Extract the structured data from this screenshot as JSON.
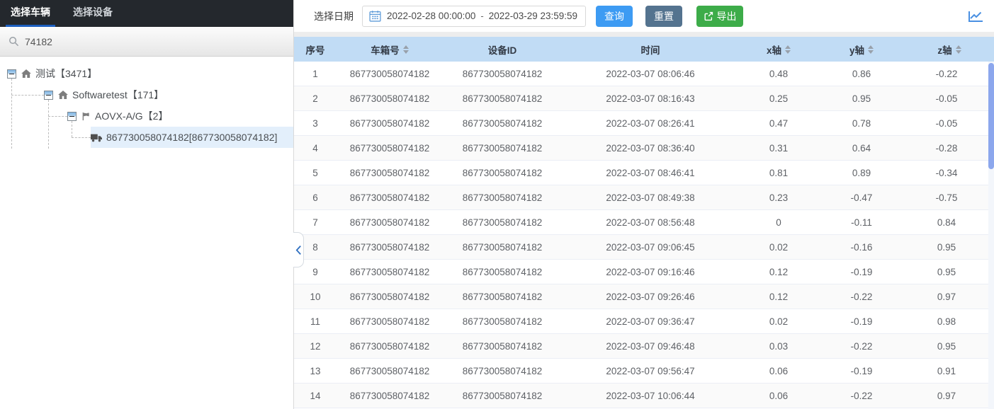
{
  "left_panel": {
    "tabs": [
      {
        "label": "选择车辆",
        "active": true
      },
      {
        "label": "选择设备",
        "active": false
      }
    ],
    "search": {
      "value": "74182"
    },
    "tree": {
      "nodes": [
        {
          "label": "测试【3471】",
          "icon": "home",
          "indent": 0,
          "expander": true,
          "selected": false
        },
        {
          "label": "Softwaretest【171】",
          "icon": "home",
          "indent": 1,
          "expander": true,
          "selected": false
        },
        {
          "label": "AOVX-A/G【2】",
          "icon": "flag",
          "indent": 2,
          "expander": true,
          "selected": false
        },
        {
          "label": "867730058074182[867730058074182]",
          "icon": "truck",
          "indent": 3,
          "expander": false,
          "selected": true
        }
      ]
    }
  },
  "toolbar": {
    "date_label": "选择日期",
    "date_start": "2022-02-28 00:00:00",
    "date_separator": "-",
    "date_end": "2022-03-29 23:59:59",
    "query_label": "查询",
    "reset_label": "重置",
    "export_label": "导出"
  },
  "table": {
    "columns": [
      {
        "label": "序号",
        "sortable": false
      },
      {
        "label": "车箱号",
        "sortable": true
      },
      {
        "label": "设备ID",
        "sortable": false
      },
      {
        "label": "时间",
        "sortable": false
      },
      {
        "label": "x轴",
        "sortable": true
      },
      {
        "label": "y轴",
        "sortable": true
      },
      {
        "label": "z轴",
        "sortable": true
      }
    ],
    "rows": [
      [
        "1",
        "867730058074182",
        "867730058074182",
        "2022-03-07 08:06:46",
        "0.48",
        "0.86",
        "-0.22"
      ],
      [
        "2",
        "867730058074182",
        "867730058074182",
        "2022-03-07 08:16:43",
        "0.25",
        "0.95",
        "-0.05"
      ],
      [
        "3",
        "867730058074182",
        "867730058074182",
        "2022-03-07 08:26:41",
        "0.47",
        "0.78",
        "-0.05"
      ],
      [
        "4",
        "867730058074182",
        "867730058074182",
        "2022-03-07 08:36:40",
        "0.31",
        "0.64",
        "-0.28"
      ],
      [
        "5",
        "867730058074182",
        "867730058074182",
        "2022-03-07 08:46:41",
        "0.81",
        "0.89",
        "-0.34"
      ],
      [
        "6",
        "867730058074182",
        "867730058074182",
        "2022-03-07 08:49:38",
        "0.23",
        "-0.47",
        "-0.75"
      ],
      [
        "7",
        "867730058074182",
        "867730058074182",
        "2022-03-07 08:56:48",
        "0",
        "-0.11",
        "0.84"
      ],
      [
        "8",
        "867730058074182",
        "867730058074182",
        "2022-03-07 09:06:45",
        "0.02",
        "-0.16",
        "0.95"
      ],
      [
        "9",
        "867730058074182",
        "867730058074182",
        "2022-03-07 09:16:46",
        "0.12",
        "-0.19",
        "0.95"
      ],
      [
        "10",
        "867730058074182",
        "867730058074182",
        "2022-03-07 09:26:46",
        "0.12",
        "-0.22",
        "0.97"
      ],
      [
        "11",
        "867730058074182",
        "867730058074182",
        "2022-03-07 09:36:47",
        "0.02",
        "-0.19",
        "0.98"
      ],
      [
        "12",
        "867730058074182",
        "867730058074182",
        "2022-03-07 09:46:48",
        "0.03",
        "-0.22",
        "0.95"
      ],
      [
        "13",
        "867730058074182",
        "867730058074182",
        "2022-03-07 09:56:47",
        "0.06",
        "-0.19",
        "0.91"
      ],
      [
        "14",
        "867730058074182",
        "867730058074182",
        "2022-03-07 10:06:44",
        "0.06",
        "-0.22",
        "0.97"
      ]
    ]
  },
  "colors": {
    "dark_header_bg": "#24282d",
    "active_tab_underline": "#1d5fc0",
    "selected_node_bg": "#e3effb",
    "table_header_bg": "#c1dcf5",
    "query_button": "#3d9bf3",
    "reset_button": "#54738f",
    "export_button": "#3dac49",
    "scrollbar_thumb": "#8ca7ed",
    "chart_icon_blue": "#4a90e2"
  }
}
